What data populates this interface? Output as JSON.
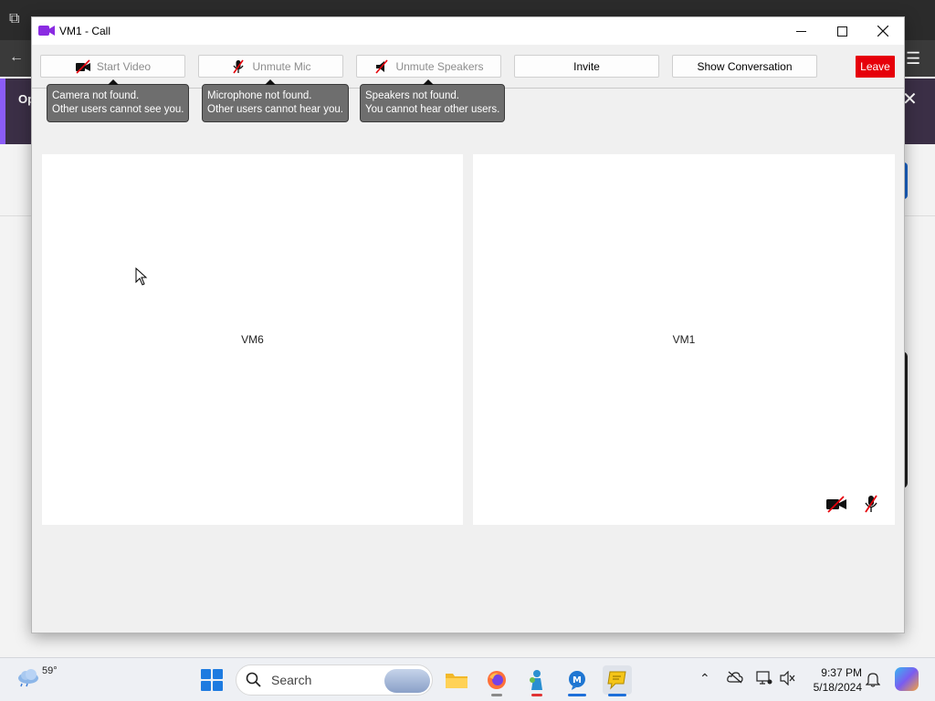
{
  "window": {
    "title": "VM1 - Call",
    "controls": {
      "minimize": "—",
      "maximize": "☐",
      "close": "✕"
    }
  },
  "toolbar": {
    "start_video": "Start Video",
    "unmute_mic": "Unmute Mic",
    "unmute_speakers": "Unmute Speakers",
    "invite": "Invite",
    "show_conversation": "Show Conversation",
    "leave": "Leave"
  },
  "tooltips": {
    "camera": [
      "Camera not found.",
      "Other users cannot see you."
    ],
    "microphone": [
      "Microphone not found.",
      "Other users cannot hear you."
    ],
    "speakers": [
      "Speakers not found.",
      "You cannot hear other users."
    ]
  },
  "tiles": {
    "left_name": "VM6",
    "right_name": "VM1",
    "right_icons": [
      "video-off-icon",
      "mic-off-icon"
    ]
  },
  "background": {
    "banner_text": "Op"
  },
  "taskbar": {
    "weather_temp": "59°",
    "search_placeholder": "Search",
    "time": "9:37 PM",
    "date": "5/18/2024",
    "apps": [
      "file-explorer-icon",
      "firefox-icon",
      "app-icon",
      "messenger-icon",
      "chat-bubble-icon"
    ]
  },
  "colors": {
    "leave_red": "#e6000a",
    "tooltip_bg": "#6e6e6e",
    "title_icon_purple": "#8a2be2",
    "start_blue": "#1e7be0"
  }
}
